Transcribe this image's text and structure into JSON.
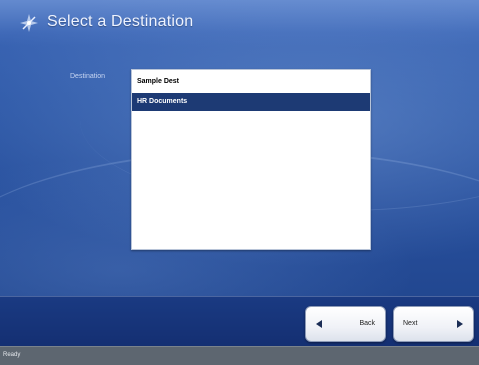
{
  "header": {
    "title": "Select a Destination",
    "icon": "compass-icon"
  },
  "form": {
    "destination_label": "Destination",
    "destinations": [
      "Sample Dest",
      "HR Documents"
    ],
    "selected_index": 1
  },
  "footer": {
    "back_label": "Back",
    "next_label": "Next",
    "back_icon": "arrow-left-icon",
    "next_icon": "arrow-right-icon"
  },
  "status": {
    "text": "Ready"
  },
  "colors": {
    "selection": "#1d3a74",
    "background": "#2f5aa9"
  }
}
